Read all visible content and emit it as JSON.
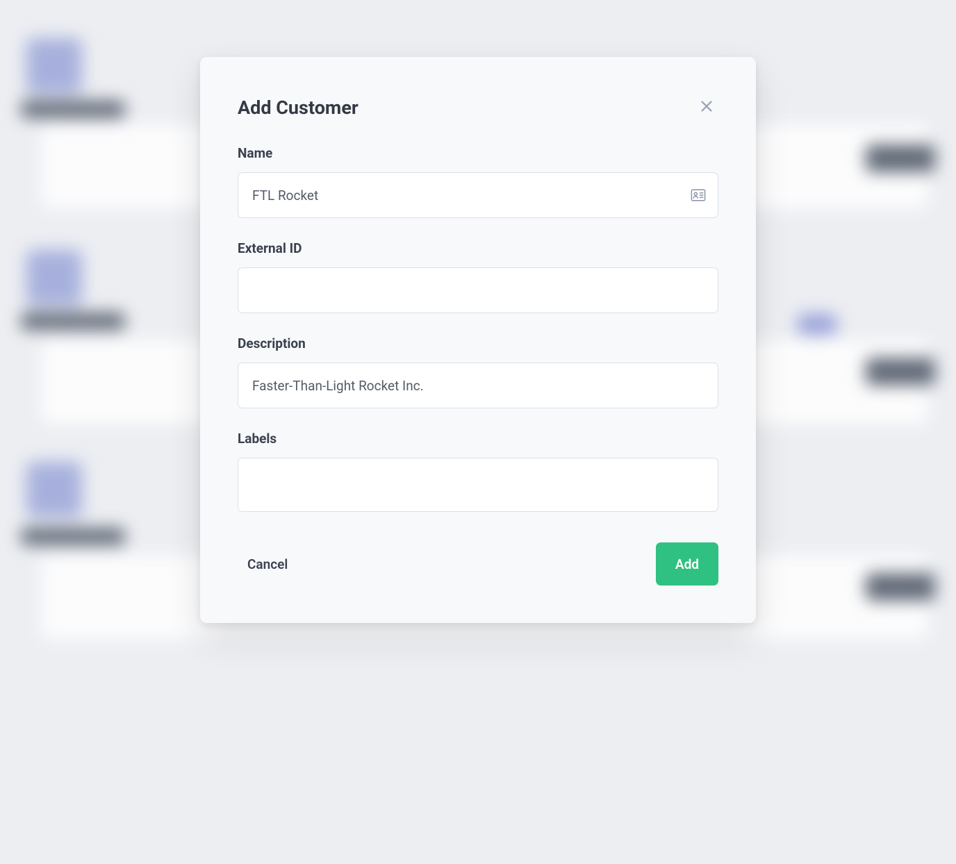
{
  "modal": {
    "title": "Add Customer",
    "fields": {
      "name": {
        "label": "Name",
        "value": "FTL Rocket",
        "placeholder": ""
      },
      "external_id": {
        "label": "External ID",
        "value": "",
        "placeholder": ""
      },
      "description": {
        "label": "Description",
        "value": "Faster-Than-Light Rocket Inc.",
        "placeholder": ""
      },
      "labels": {
        "label": "Labels",
        "values": []
      }
    },
    "buttons": {
      "cancel": "Cancel",
      "add": "Add"
    }
  },
  "colors": {
    "accent": "#2fc181",
    "text_primary": "#343a45",
    "text_secondary": "#535b68",
    "border": "#dbe0e7",
    "modal_bg": "#f8f9fb"
  }
}
